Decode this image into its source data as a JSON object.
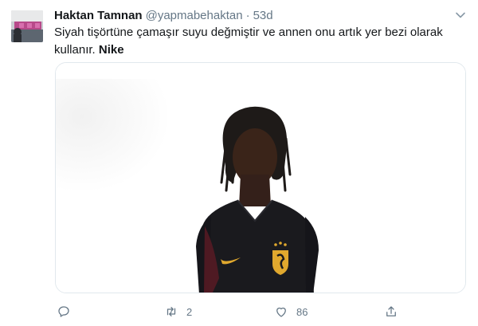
{
  "tweet": {
    "author_name": "Haktan Tamnan",
    "handle": "@yapmabehaktan",
    "separator": "·",
    "time": "53d",
    "text_main": "Siyah tişörtüne çamaşır suyu değmiştir ve annen onu artık yer bezi olarak kullanır.",
    "text_bold": "Nike"
  },
  "actions": {
    "reply_icon": "reply-icon",
    "retweet_icon": "retweet-icon",
    "retweet_count": "2",
    "like_icon": "heart-icon",
    "like_count": "86",
    "share_icon": "share-icon"
  },
  "colors": {
    "text": "#14171a",
    "secondary": "#657786",
    "border": "#e1e8ed",
    "jersey": "#1a1a1e",
    "crest": "#e0a82e"
  }
}
